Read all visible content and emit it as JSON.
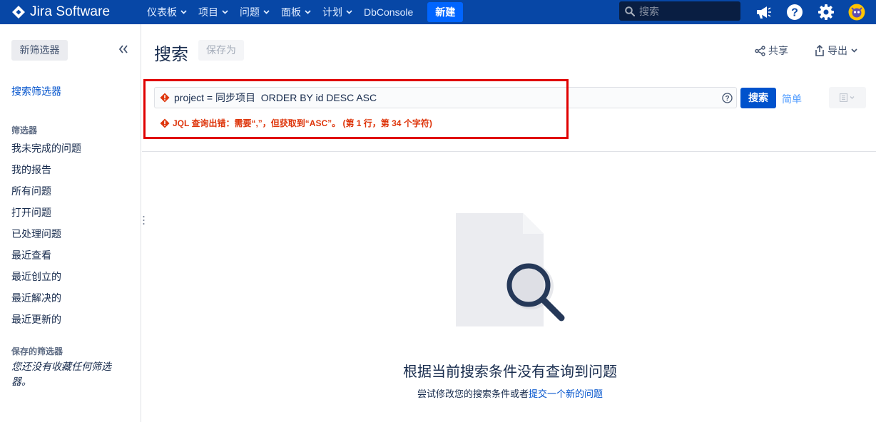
{
  "app": {
    "name": "Jira Software"
  },
  "nav": {
    "items": [
      {
        "label": "仪表板"
      },
      {
        "label": "项目"
      },
      {
        "label": "问题"
      },
      {
        "label": "面板"
      },
      {
        "label": "计划"
      }
    ],
    "dbconsole": "DbConsole",
    "create_label": "新建",
    "search_placeholder": "搜索",
    "icons": [
      "megaphone-icon",
      "help-icon",
      "settings-gear-icon",
      "user-avatar"
    ]
  },
  "sidebar": {
    "new_filter_label": "新筛选器",
    "collapse_icon": "double-chevron-left-icon",
    "search_filters_link": "搜索筛选器",
    "filters_heading": "筛选器",
    "filters": [
      "我未完成的问题",
      "我的报告",
      "所有问题",
      "打开问题",
      "已处理问题",
      "最近查看",
      "最近创立的",
      "最近解决的",
      "最近更新的"
    ],
    "saved_heading": "保存的筛选器",
    "saved_empty": "您还没有收藏任何筛选器。"
  },
  "main": {
    "title": "搜索",
    "save_as_label": "保存为",
    "share_label": "共享",
    "export_label": "导出",
    "jql": {
      "query": "project = 同步项目  ORDER BY id DESC ASC",
      "search_button": "搜索",
      "simple_link": "简单",
      "error": "JQL 查询出错：需要“,”，但获取到“ASC”。 (第 1 行，第 34 个字符)"
    },
    "empty": {
      "title": "根据当前搜索条件没有查询到问题",
      "subtitle_prefix": "尝试修改您的搜索条件或者",
      "subtitle_link": "提交一个新的问题"
    }
  },
  "colors": {
    "topbar": "#0747a6",
    "primary": "#0052cc",
    "error": "#de350b",
    "highlight_frame": "#e00000"
  }
}
